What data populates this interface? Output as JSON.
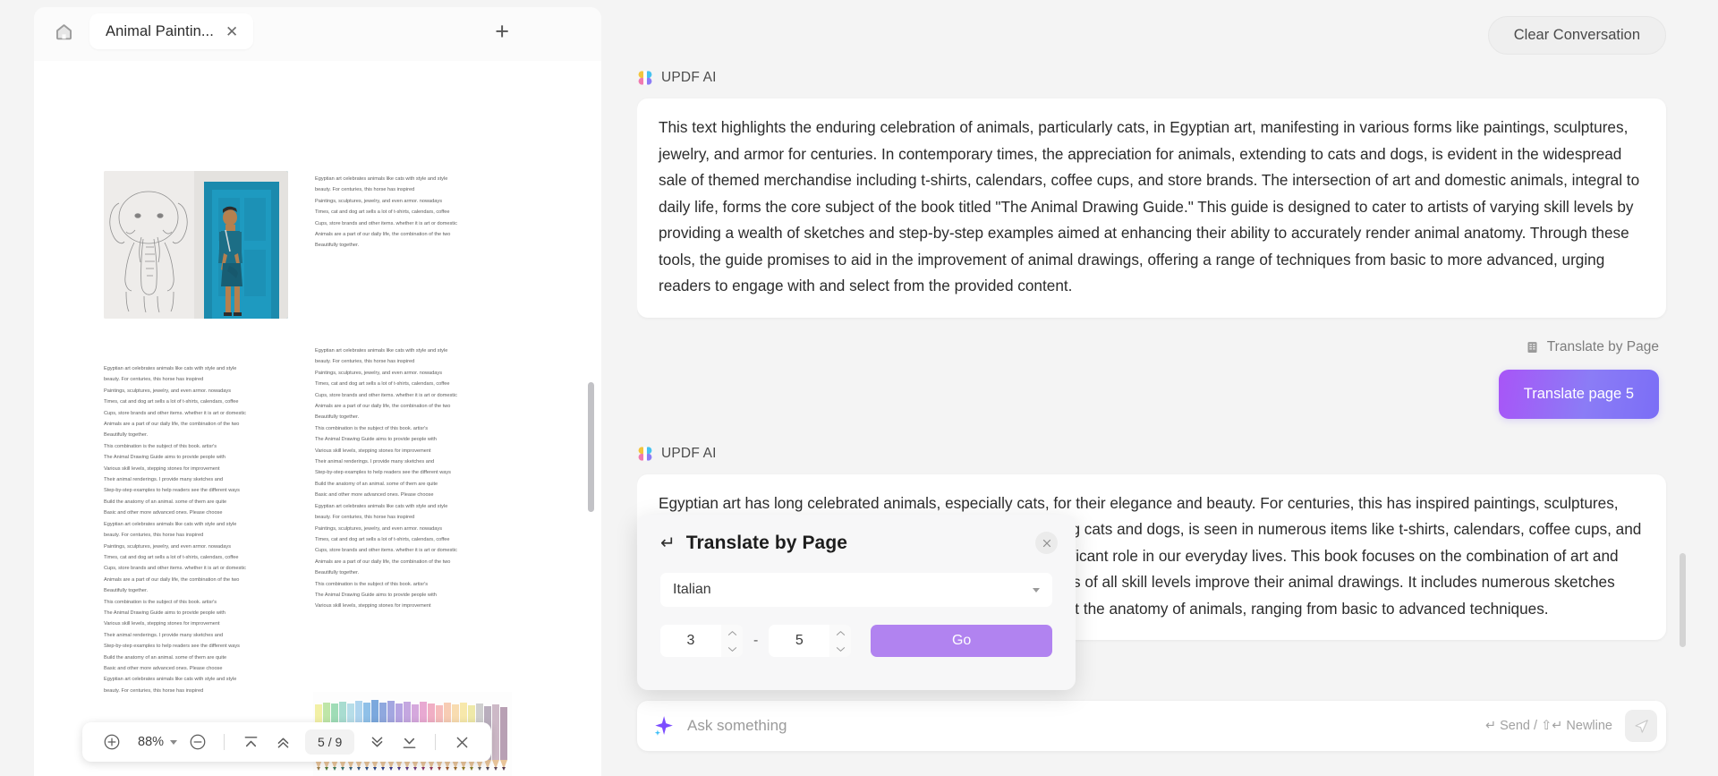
{
  "left_panel": {
    "home_icon": "home-icon",
    "tab": {
      "label": "Animal Paintin...",
      "close_icon": "close-icon"
    },
    "add_tab_label": "+",
    "toolbar": {
      "zoom_in_icon": "plus-circle-icon",
      "zoom_level": "88%",
      "zoom_out_icon": "minus-circle-icon",
      "first_page_icon": "first-page-icon",
      "prev_page_icon": "prev-page-icon",
      "page_indicator": "5 / 9",
      "next_page_icon": "next-page-icon",
      "last_page_icon": "last-page-icon",
      "close_icon": "close-icon"
    },
    "document": {
      "paragraph_lines": [
        "Egyptian art celebrates animals like cats with style and style",
        "beauty. For centuries, this horse has inspired",
        "Paintings, sculptures, jewelry, and even armor. nowadays",
        "Times, cat and dog art sells a lot of t-shirts, calendars, coffee",
        "Cups, store brands and other items. whether it is art or domestic",
        "Animals are a part of our daily life, the combination of the two",
        "Beautifully together."
      ],
      "paragraph_lines_2": [
        "This combination is the subject of this book. artisr's",
        "The Animal Drawing Guide aims to provide people with",
        "Various skill levels, stepping stones for improvement",
        "Their animal renderings. I provide many sketches and",
        "Step-by-step examples to help readers see the different ways",
        "Build the anatomy of an animal. some of them are quite",
        "Basic and other more advanced ones. Please choose"
      ],
      "image_alt_elephant": "elephant-sketch-photo",
      "image_alt_pencils": "colored-pencils-photo"
    }
  },
  "right_panel": {
    "clear_button": "Clear Conversation",
    "brand": "UPDF AI",
    "message_1": "This text highlights the enduring celebration of animals, particularly cats, in Egyptian art, manifesting in various forms like paintings, sculptures, jewelry, and armor for centuries. In contemporary times, the appreciation for animals, extending to cats and dogs, is evident in the widespread sale of themed merchandise including t-shirts, calendars, coffee cups, and store brands. The intersection of art and domestic animals, integral to daily life, forms the core subject of the book titled \"The Animal Drawing Guide.\" This guide is designed to cater to artists of varying skill levels by providing a wealth of sketches and step-by-step examples aimed at enhancing their ability to accurately render animal anatomy. Through these tools, the guide promises to aid in the improvement of animal drawings, offering a range of techniques from basic to more advanced, urging readers to engage with and select from the provided content.",
    "action_label": "Translate by Page",
    "action_icon": "document-list-icon",
    "translate_chip": "Translate page 5",
    "message_2_lines": [
      "Egyptian art has long celebrated animals, especially cats, for their elegance and beauty. For centuries, this has inspired paintings, sculptures, jewelry, and even",
      "armor. Today, the love for animals, including cats and dogs, is seen in numerous items like t-shirts, calendars, coffee cups, and more. Whether in art or as",
      "beloved pets, animals play a significant role in our everyday lives. This book focuses on the combination of art and animals. The Animal",
      "Drawing Guide is designed to help artists of all skill levels improve their animal drawings. It includes numerous sketches and",
      "step-by-step examples that demonstrate how to construct the anatomy of animals, ranging from basic to advanced techniques."
    ],
    "input": {
      "placeholder": "Ask something",
      "value": "",
      "spark_icon": "sparkle-icon",
      "hint": "↵ Send  /  ⇧↵ Newline",
      "send_icon": "send-icon"
    }
  },
  "dialog": {
    "back_icon": "back-arrow-icon",
    "title": "Translate by Page",
    "close_icon": "close-icon",
    "language": "Italian",
    "page_from": "3",
    "page_to": "5",
    "separator": "-",
    "go_label": "Go"
  },
  "colors": {
    "accent_purple": "#b183f0",
    "chip_gradient_start": "#a855f7",
    "chip_gradient_end": "#7b6ef6",
    "page_bg": "#f4f4f4",
    "bubble_bg": "#ffffff"
  }
}
